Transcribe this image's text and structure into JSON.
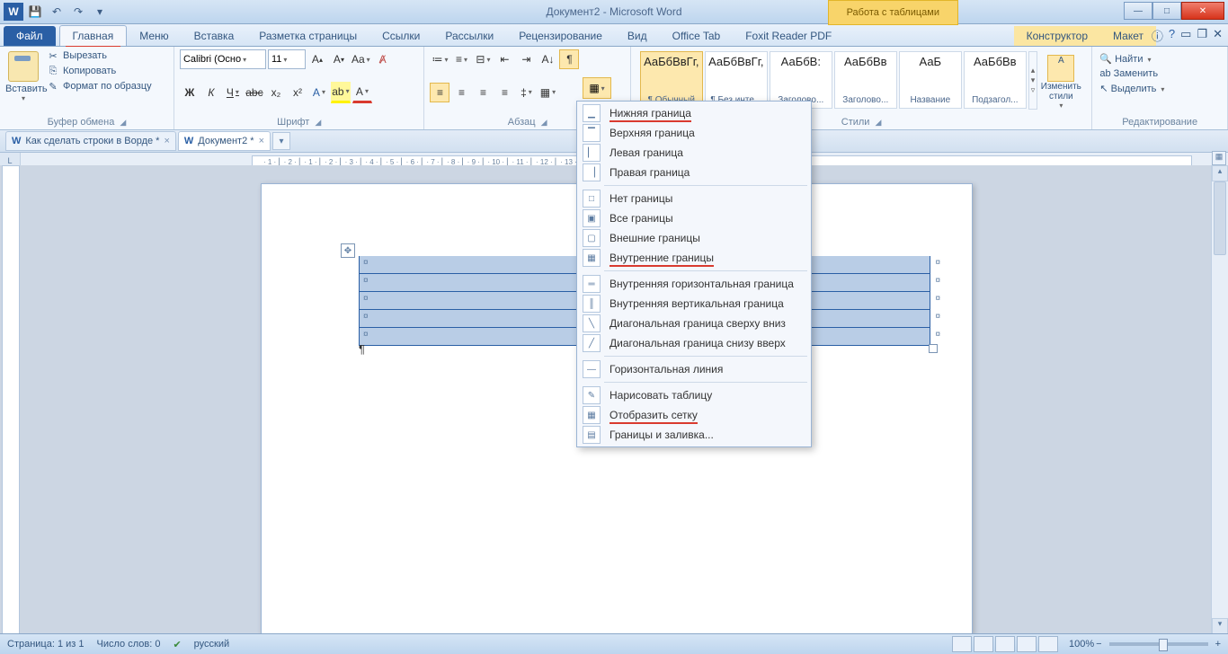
{
  "titlebar": {
    "title": "Документ2 - Microsoft Word",
    "context_tool": "Работа с таблицами"
  },
  "tabs": {
    "file": "Файл",
    "items": [
      "Главная",
      "Меню",
      "Вставка",
      "Разметка страницы",
      "Ссылки",
      "Рассылки",
      "Рецензирование",
      "Вид",
      "Office Tab",
      "Foxit Reader PDF"
    ],
    "context": [
      "Конструктор",
      "Макет"
    ],
    "active": "Главная"
  },
  "clipboard": {
    "paste": "Вставить",
    "cut": "Вырезать",
    "copy": "Копировать",
    "format_painter": "Формат по образцу",
    "group": "Буфер обмена"
  },
  "font": {
    "name": "Calibri (Осно",
    "size": "11",
    "group": "Шрифт"
  },
  "paragraph": {
    "group": "Абзац"
  },
  "styles": {
    "group": "Стили",
    "change": "Изменить стили",
    "items": [
      {
        "preview": "АаБбВвГг,",
        "label": "¶ Обычный"
      },
      {
        "preview": "АаБбВвГг,",
        "label": "¶ Без инте..."
      },
      {
        "preview": "АаБбВ:",
        "label": "Заголово..."
      },
      {
        "preview": "АаБбВв",
        "label": "Заголово..."
      },
      {
        "preview": "АаБ",
        "label": "Название"
      },
      {
        "preview": "АаБбВв",
        "label": "Подзагол..."
      }
    ]
  },
  "editing": {
    "find": "Найти",
    "replace": "Заменить",
    "select": "Выделить",
    "group": "Редактирование"
  },
  "doc_tabs": [
    {
      "label": "Как сделать строки в Ворде *",
      "active": false
    },
    {
      "label": "Документ2 *",
      "active": true
    }
  ],
  "ruler_marks": "· 1 · ⎜ · 2 · ⎜ · 1 · ⎜ · 2 · ⎜ · 3 · ⎜ · 4 · ⎜ · 5 · ⎜ · 6 · ⎜ · 7 · ⎜ · 8 · ⎜ · 9 · ⎜ · 10 · ⎜ · 11 · ⎜ · 12 · ⎜ · 13 · ⎜ · 14 · ⎜ · 15 · ⎜ · 16 · ⎜ · 17 · ⎜ · 18",
  "border_menu": {
    "items": [
      {
        "label": "Нижняя граница",
        "hl": true
      },
      {
        "label": "Верхняя граница"
      },
      {
        "label": "Левая граница"
      },
      {
        "label": "Правая граница"
      },
      {
        "sep": true
      },
      {
        "label": "Нет границы"
      },
      {
        "label": "Все границы"
      },
      {
        "label": "Внешние границы"
      },
      {
        "label": "Внутренние границы",
        "hl": true
      },
      {
        "sep": true
      },
      {
        "label": "Внутренняя горизонтальная граница"
      },
      {
        "label": "Внутренняя вертикальная граница"
      },
      {
        "label": "Диагональная граница сверху вниз"
      },
      {
        "label": "Диагональная граница снизу вверх"
      },
      {
        "sep": true
      },
      {
        "label": "Горизонтальная линия"
      },
      {
        "sep": true
      },
      {
        "label": "Нарисовать таблицу"
      },
      {
        "label": "Отобразить сетку",
        "hl": true
      },
      {
        "label": "Границы и заливка..."
      }
    ]
  },
  "status": {
    "page": "Страница: 1 из 1",
    "words": "Число слов: 0",
    "lang": "русский",
    "zoom": "100%",
    "zoom_plus": "+",
    "zoom_minus": "−"
  },
  "icons": {
    "scissors": "✂",
    "copy": "⎘",
    "brush": "✎",
    "search": "🔍",
    "arrows": "↔",
    "word": "W",
    "save": "💾",
    "undo": "↶",
    "redo": "↷"
  }
}
